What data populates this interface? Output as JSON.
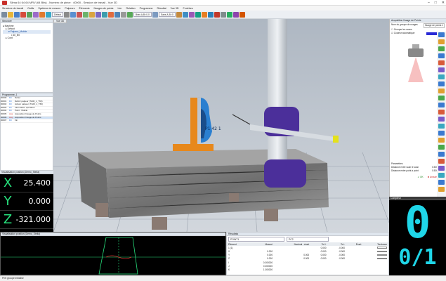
{
  "window": {
    "title": "Silma 64 64 64 MRV (64 Bits) - Numéro de pièce : 40000 - Session de travail - Vue 3D"
  },
  "menu": [
    "Structure de travail",
    "Outils",
    "Système de mesure",
    "Palpeurs",
    "Éléments",
    "Nuages de points",
    "Lier",
    "Relation",
    "Programme",
    "Résultat",
    "Vue 3D",
    "Fenêtres"
  ],
  "toolbar": {
    "sel1": "Défaut",
    "sel2": "Bras A,B=0,0",
    "sel3": "Sans A,B=0"
  },
  "structure": {
    "title": "Structure",
    "items": [
      "Machine",
      "Défaut",
      "Palpeur_Mobile",
      "A0_B0",
      "Cont"
    ]
  },
  "program": {
    "title": "Programme_1",
    "rows": [
      {
        "n": "00000",
        "kind": "Dir",
        "text": "Début"
      },
      {
        "n": "00001",
        "kind": "Dir",
        "text": "Définir palpeur (TA00_1_T60)"
      },
      {
        "n": "00002",
        "kind": "Dir",
        "text": "Activer palpeur (TA00_1_T60)"
      },
      {
        "n": "00003",
        "kind": "Dir",
        "text": "Information opérateur"
      },
      {
        "n": "00004",
        "kind": "Dir",
        "text": "Point : Mobile"
      },
      {
        "n": "00005",
        "kind": "Acq",
        "text": "Acquisition Nuage de Points"
      },
      {
        "n": "00006",
        "kind": "Acq",
        "text": "Acquisition Nuage de Points"
      },
      {
        "n": "00007",
        "kind": "Dir",
        "text": "Fin"
      }
    ]
  },
  "position": {
    "title": "Visualisation position (Demo_Stelia)",
    "axes": [
      {
        "name": "X",
        "value": "25.400"
      },
      {
        "name": "Y",
        "value": "0.000"
      },
      {
        "name": "Z",
        "value": "-321.000"
      }
    ]
  },
  "viewport": {
    "tab": "Vue 3D",
    "annotation": "P1 42 1"
  },
  "right_panel": {
    "title": "Acquisition Nuage de Points",
    "cloud_label": "Nom du groupe de nuages",
    "cloud_value": "Nuage de points 1",
    "opt1": "Grouper les scans",
    "opt2": "Couleur automatique",
    "section": "Paramètres",
    "dist_label": "Distance entre scan le scan",
    "dist_value": "0.500",
    "dist2_label": "Distance entre point à point",
    "dist2_value": "0.500",
    "ok": "OK",
    "cancel": "Annuler"
  },
  "counter": {
    "title": "Compteur",
    "big": "0",
    "small": "0/1"
  },
  "bottom_left": {
    "title": "Visualisation position (Demo_Stelia)"
  },
  "results": {
    "title": "Résultats",
    "combo1": "POINT1",
    "combo2": "PC2",
    "columns": [
      "Élément",
      "Mesuré",
      "Nominal - écart",
      "Tol.+",
      "Tol.-",
      "Écart",
      "Tendance"
    ],
    "rows": [
      {
        "name": "1 (1)",
        "measured": "",
        "nominal": "",
        "tp": "0.000",
        "tm": "-0.000"
      },
      {
        "name": "X",
        "measured": "0.000",
        "nominal": "",
        "tp": "0.000",
        "tm": "-0.000"
      },
      {
        "name": "Y",
        "measured": "0.000",
        "nominal": "0.000",
        "tp": "0.000",
        "tm": "-0.000"
      },
      {
        "name": "Z",
        "measured": "0.000",
        "nominal": "0.000",
        "tp": "0.000",
        "tm": "-0.000"
      },
      {
        "name": "I",
        "measured": "0.000000",
        "nominal": "",
        "tp": "",
        "tm": ""
      },
      {
        "name": "J",
        "measured": "0.000000",
        "nominal": "",
        "tp": "",
        "tm": ""
      },
      {
        "name": "K",
        "measured": "1.000000",
        "nominal": "",
        "tp": "",
        "tm": ""
      }
    ]
  },
  "status": {
    "text": "Pret groupe initialisé"
  },
  "colors": {
    "accent": "#2a6fd6",
    "green": "#27e27d",
    "cyan": "#1fd6e8",
    "purple": "#4b2f9a",
    "orange": "#e7881c"
  }
}
